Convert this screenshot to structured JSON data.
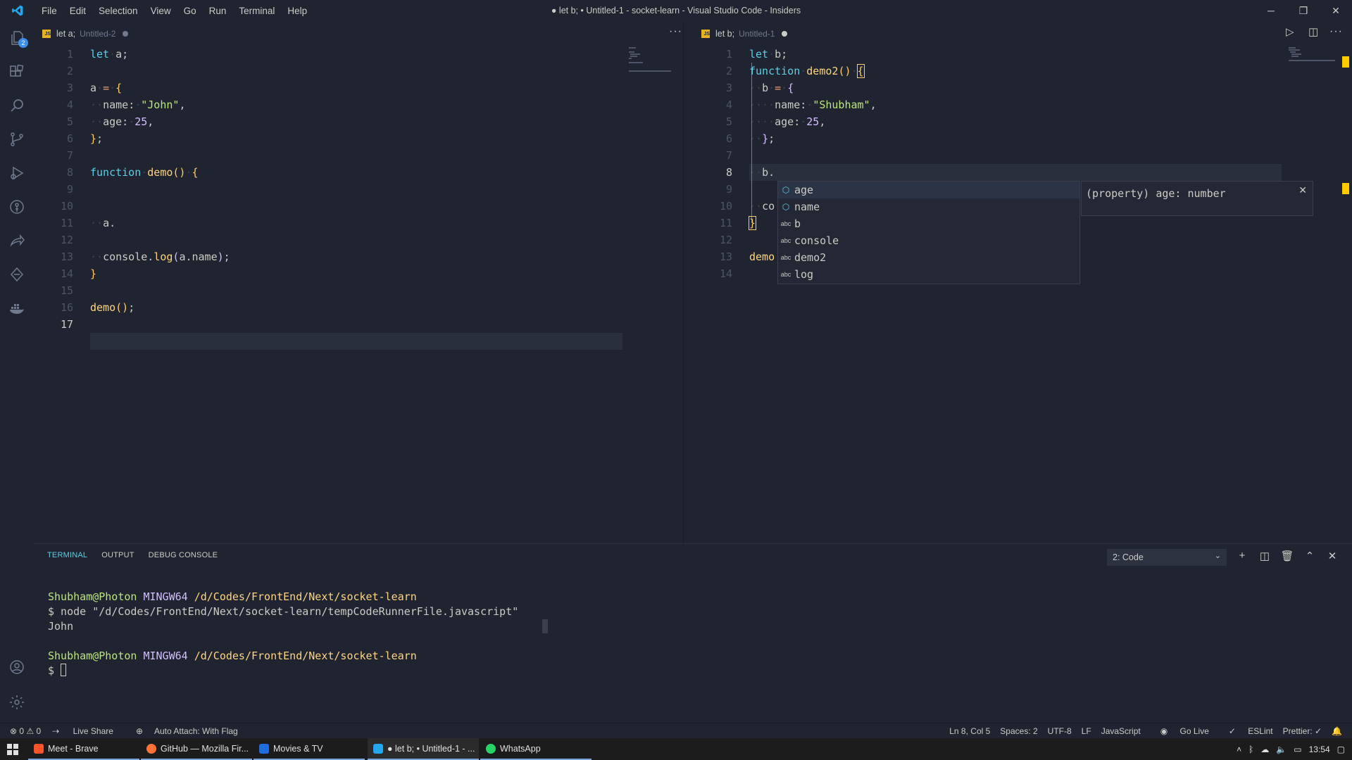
{
  "window": {
    "title": "● let b; • Untitled-1 - socket-learn - Visual Studio Code - Insiders",
    "menu": [
      "File",
      "Edit",
      "Selection",
      "View",
      "Go",
      "Run",
      "Terminal",
      "Help"
    ],
    "controls": {
      "minimize": "─",
      "restore": "❐",
      "close": "✕"
    }
  },
  "activity_bar": {
    "explorer_badge": "2",
    "icons": [
      "files-icon",
      "extensions-icon",
      "search-icon",
      "source-control-icon",
      "run-debug-icon",
      "gitlens-icon",
      "live-share-icon",
      "remote-icon",
      "docker-icon",
      "account-icon",
      "settings-gear-icon"
    ]
  },
  "editor_left": {
    "tab": {
      "icon": "JS",
      "label": "let a;",
      "description": "Untitled-2"
    },
    "more_actions": "···",
    "active_line": "17",
    "line_numbers": [
      "1",
      "2",
      "3",
      "4",
      "5",
      "6",
      "7",
      "8",
      "9",
      "10",
      "11",
      "12",
      "13",
      "14",
      "15",
      "16",
      "17"
    ]
  },
  "editor_right": {
    "tab": {
      "icon": "JS",
      "label": "let b;",
      "description": "Untitled-1"
    },
    "actions": {
      "run": "▷",
      "split": "◫",
      "more": "···"
    },
    "active_line": "8",
    "line_numbers": [
      "1",
      "2",
      "3",
      "4",
      "5",
      "6",
      "7",
      "8",
      "9",
      "10",
      "11",
      "12",
      "13",
      "14"
    ]
  },
  "suggest": {
    "items": [
      {
        "kind": "property",
        "label": "age"
      },
      {
        "kind": "property",
        "label": "name"
      },
      {
        "kind": "abc",
        "label": "b"
      },
      {
        "kind": "abc",
        "label": "console"
      },
      {
        "kind": "abc",
        "label": "demo2"
      },
      {
        "kind": "abc",
        "label": "log"
      }
    ],
    "detail": "(property) age: number",
    "close": "✕"
  },
  "panel": {
    "tabs": [
      "TERMINAL",
      "OUTPUT",
      "DEBUG CONSOLE"
    ],
    "terminal_select": "2: Code",
    "actions": {
      "new": "+",
      "split": "◫",
      "kill": "🗑",
      "maximize": "⌃",
      "close": "✕"
    },
    "prompt1": {
      "user": "Shubham@Photon",
      "host": "MINGW64",
      "path": "/d/Codes/FrontEnd/Next/socket-learn"
    },
    "command": "$ node \"/d/Codes/FrontEnd/Next/socket-learn/tempCodeRunnerFile.javascript\"",
    "output": "John",
    "prompt2": {
      "user": "Shubham@Photon",
      "host": "MINGW64",
      "path": "/d/Codes/FrontEnd/Next/socket-learn"
    },
    "dollar": "$"
  },
  "status_bar": {
    "problems": "⊗ 0 ⚠ 0",
    "live_share": "Live Share",
    "auto_attach": "Auto Attach: With Flag",
    "position": "Ln 8, Col 5",
    "spaces": "Spaces: 2",
    "encoding": "UTF-8",
    "eol": "LF",
    "language": "JavaScript",
    "go_live": "Go Live",
    "eslint": "ESLint",
    "prettier": "Prettier: ✓"
  },
  "taskbar": {
    "items": [
      "Meet - Brave",
      "GitHub — Mozilla Fir...",
      "Movies & TV",
      "● let b; • Untitled-1 - ...",
      "WhatsApp"
    ],
    "clock": "13:54"
  },
  "colors": {
    "background": "#1f2430",
    "accent": "#5ccfe6",
    "string": "#bae67e",
    "number": "#d4bfff",
    "bracket": "#ffcc66"
  }
}
